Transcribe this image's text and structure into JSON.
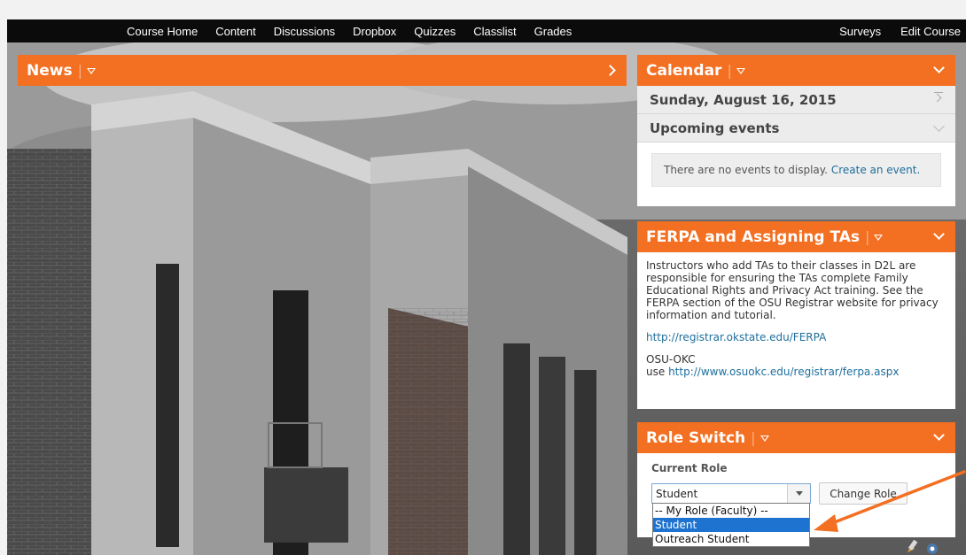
{
  "nav": {
    "left_items": [
      "Course Home",
      "Content",
      "Discussions",
      "Dropbox",
      "Quizzes",
      "Classlist",
      "Grades"
    ],
    "right_items": [
      "Surveys",
      "Edit Course"
    ]
  },
  "news": {
    "title": "News"
  },
  "calendar": {
    "title": "Calendar",
    "date": "Sunday, August 16, 2015",
    "upcoming_label": "Upcoming events",
    "no_events_text": "There are no events to display.",
    "create_link": "Create an event."
  },
  "ferpa": {
    "title": "FERPA and Assigning TAs",
    "paragraph": "Instructors who add TAs to their classes in D2L are responsible for ensuring the TAs complete Family Educational Rights and Privacy Act training. See the FERPA section of the OSU Registrar website for privacy information and tutorial.",
    "link1": "http://registrar.okstate.edu/FERPA",
    "okc_label": "OSU-OKC",
    "use_label": "use",
    "link2": "http://www.osuokc.edu/registrar/ferpa.aspx"
  },
  "role_switch": {
    "title": "Role Switch",
    "current_role_label": "Current Role",
    "selected_value": "Student",
    "change_button": "Change Role",
    "options": [
      "-- My Role (Faculty) --",
      "Student",
      "Outreach Student"
    ],
    "highlighted_option_index": 1
  },
  "colors": {
    "accent": "#f36f21",
    "nav_bg": "#0b0b0b",
    "link": "#1d6e9c",
    "selection": "#1e73d0",
    "annotation_arrow": "#f36f21"
  }
}
